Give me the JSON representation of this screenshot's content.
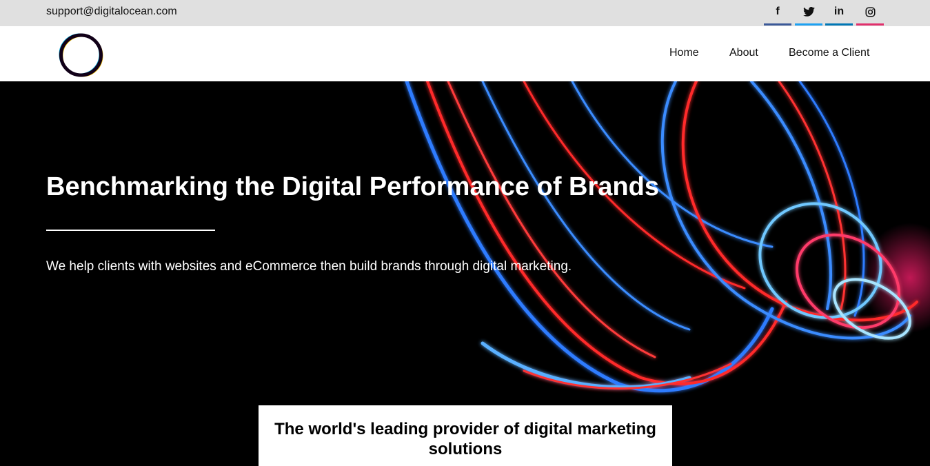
{
  "topbar": {
    "email": "support@digitalocean.com",
    "social": [
      {
        "icon": "facebook-icon",
        "glyph": "f",
        "color": "#3b5998"
      },
      {
        "icon": "twitter-icon",
        "glyph": "",
        "color": "#1da1f2"
      },
      {
        "icon": "linkedin-icon",
        "glyph": "in",
        "color": "#0077b5"
      },
      {
        "icon": "instagram-icon",
        "glyph": "",
        "color": "#e1306c"
      }
    ]
  },
  "nav": {
    "logo_icon": "ring-logo-icon",
    "items": [
      "Home",
      "About",
      "Become a Client"
    ]
  },
  "hero": {
    "headline": "Benchmarking the Digital Performance of Brands",
    "subtitle": "We help clients with websites and eCommerce then build brands through digital marketing.",
    "card_text": "The world's leading provider of digital marketing solutions"
  },
  "colors": {
    "topbar_bg": "#e0e0e0",
    "hero_bg": "#000000",
    "light_red": "#ff2a2a",
    "light_blue": "#2f7bff"
  }
}
